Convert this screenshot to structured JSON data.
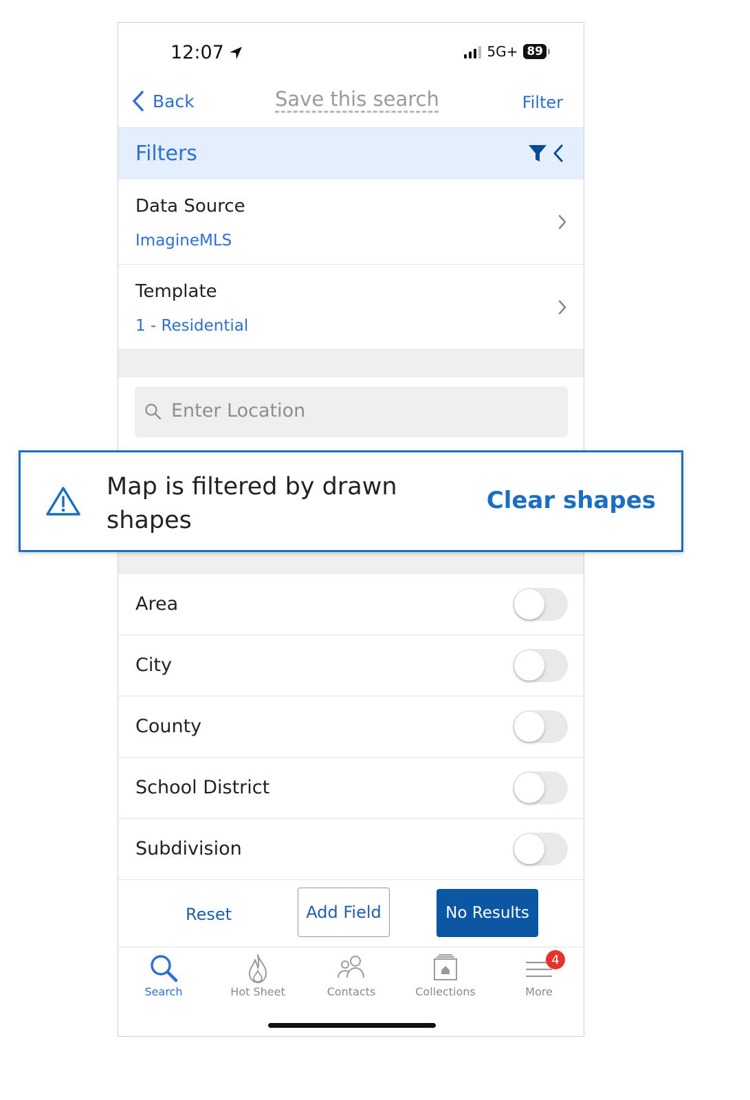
{
  "status_bar": {
    "time": "12:07",
    "network": "5G+",
    "battery": "89"
  },
  "nav": {
    "back_label": "Back",
    "title": "Save this search",
    "filter_label": "Filter"
  },
  "filters_header": {
    "label": "Filters"
  },
  "data_source": {
    "label": "Data Source",
    "value": "ImagineMLS"
  },
  "template": {
    "label": "Template",
    "value": "1 - Residential"
  },
  "search": {
    "placeholder": "Enter Location"
  },
  "callout": {
    "message": "Map is filtered by drawn shapes",
    "action": "Clear shapes"
  },
  "toggles": [
    {
      "label": "Area",
      "on": false
    },
    {
      "label": "City",
      "on": false
    },
    {
      "label": "County",
      "on": false
    },
    {
      "label": "School District",
      "on": false
    },
    {
      "label": "Subdivision",
      "on": false
    }
  ],
  "actions": {
    "reset": "Reset",
    "add_field": "Add Field",
    "results": "No Results"
  },
  "tabs": [
    {
      "label": "Search",
      "icon": "search-icon",
      "active": true
    },
    {
      "label": "Hot Sheet",
      "icon": "flame-icon",
      "active": false
    },
    {
      "label": "Contacts",
      "icon": "contacts-icon",
      "active": false
    },
    {
      "label": "Collections",
      "icon": "collections-icon",
      "active": false
    },
    {
      "label": "More",
      "icon": "menu-icon",
      "active": false,
      "badge": "4"
    }
  ],
  "colors": {
    "accent": "#2d6fd3",
    "primary_button": "#0b57a4",
    "header_bg": "#e3effc",
    "badge": "#e8332a"
  }
}
